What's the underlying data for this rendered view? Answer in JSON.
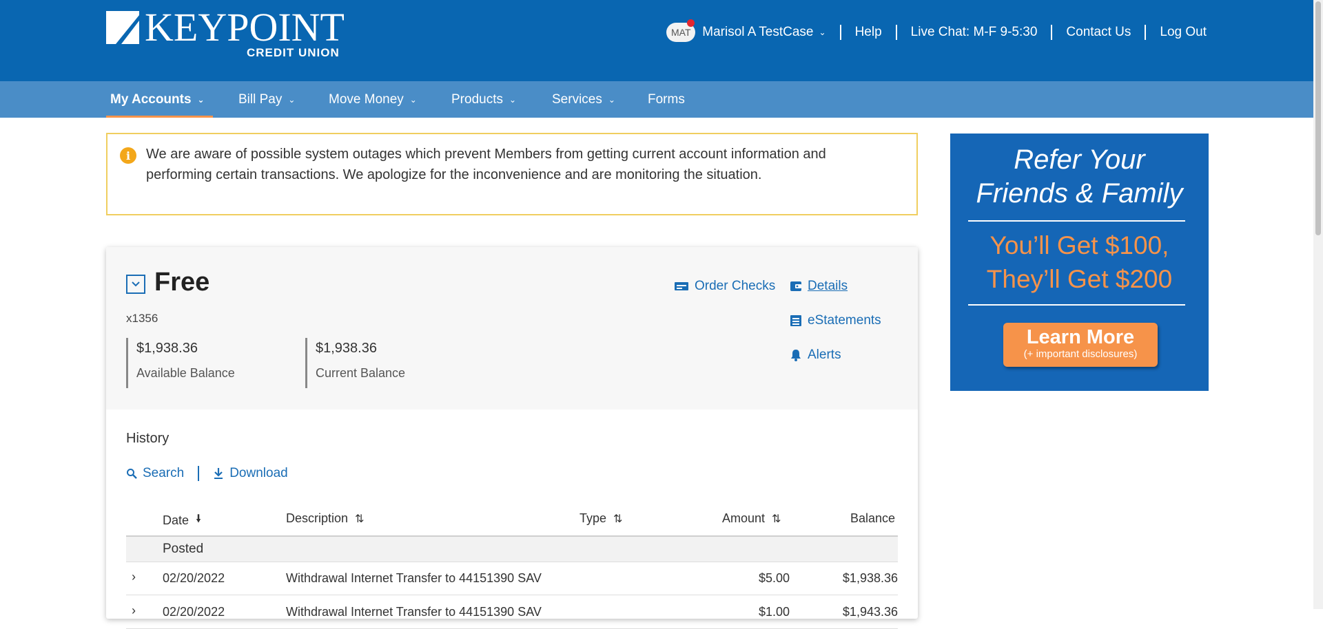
{
  "brand": {
    "name": "KEYPOINT",
    "subtitle": "CREDIT UNION"
  },
  "user_nav": {
    "avatar_initials": "MAT",
    "user_name": "Marisol A TestCase",
    "help": "Help",
    "live_chat": "Live Chat: M-F 9-5:30",
    "contact": "Contact Us",
    "logout": "Log Out"
  },
  "main_nav": {
    "items": [
      {
        "label": "My Accounts"
      },
      {
        "label": "Bill Pay"
      },
      {
        "label": "Move Money"
      },
      {
        "label": "Products"
      },
      {
        "label": "Services"
      },
      {
        "label": "Forms"
      }
    ]
  },
  "alert": {
    "message": "We are aware of possible system outages which prevent Members from getting current account information and performing certain transactions. We apologize for the inconvenience and are monitoring the situation."
  },
  "account": {
    "name": "Free",
    "number": "x1356",
    "available_balance": "$1,938.36",
    "available_label": "Available Balance",
    "current_balance": "$1,938.36",
    "current_label": "Current Balance",
    "links": {
      "order_checks": "Order Checks",
      "details": "Details",
      "estatements": "eStatements",
      "alerts": "Alerts"
    }
  },
  "history": {
    "title": "History",
    "search": "Search",
    "download": "Download",
    "columns": {
      "date": "Date",
      "description": "Description",
      "type": "Type",
      "amount": "Amount",
      "balance": "Balance"
    },
    "group_label": "Posted",
    "rows": [
      {
        "date": "02/20/2022",
        "description": "Withdrawal Internet Transfer to 44151390 SAV",
        "type": "",
        "amount": "$5.00",
        "balance": "$1,938.36"
      },
      {
        "date": "02/20/2022",
        "description": "Withdrawal Internet Transfer to 44151390 SAV",
        "type": "",
        "amount": "$1.00",
        "balance": "$1,943.36"
      }
    ]
  },
  "ad": {
    "line1": "Refer Your",
    "line2": "Friends & Family",
    "line3": "You’ll Get $100,",
    "line4": "They’ll Get $200",
    "button": "Learn More",
    "button_sub": "(+ important disclosures)"
  },
  "colors": {
    "header_blue": "#0966b1",
    "nav_blue": "#4a8dc7",
    "accent_orange": "#f6934a",
    "link_blue": "#1a6db5",
    "alert_border": "#f0ce5f"
  }
}
